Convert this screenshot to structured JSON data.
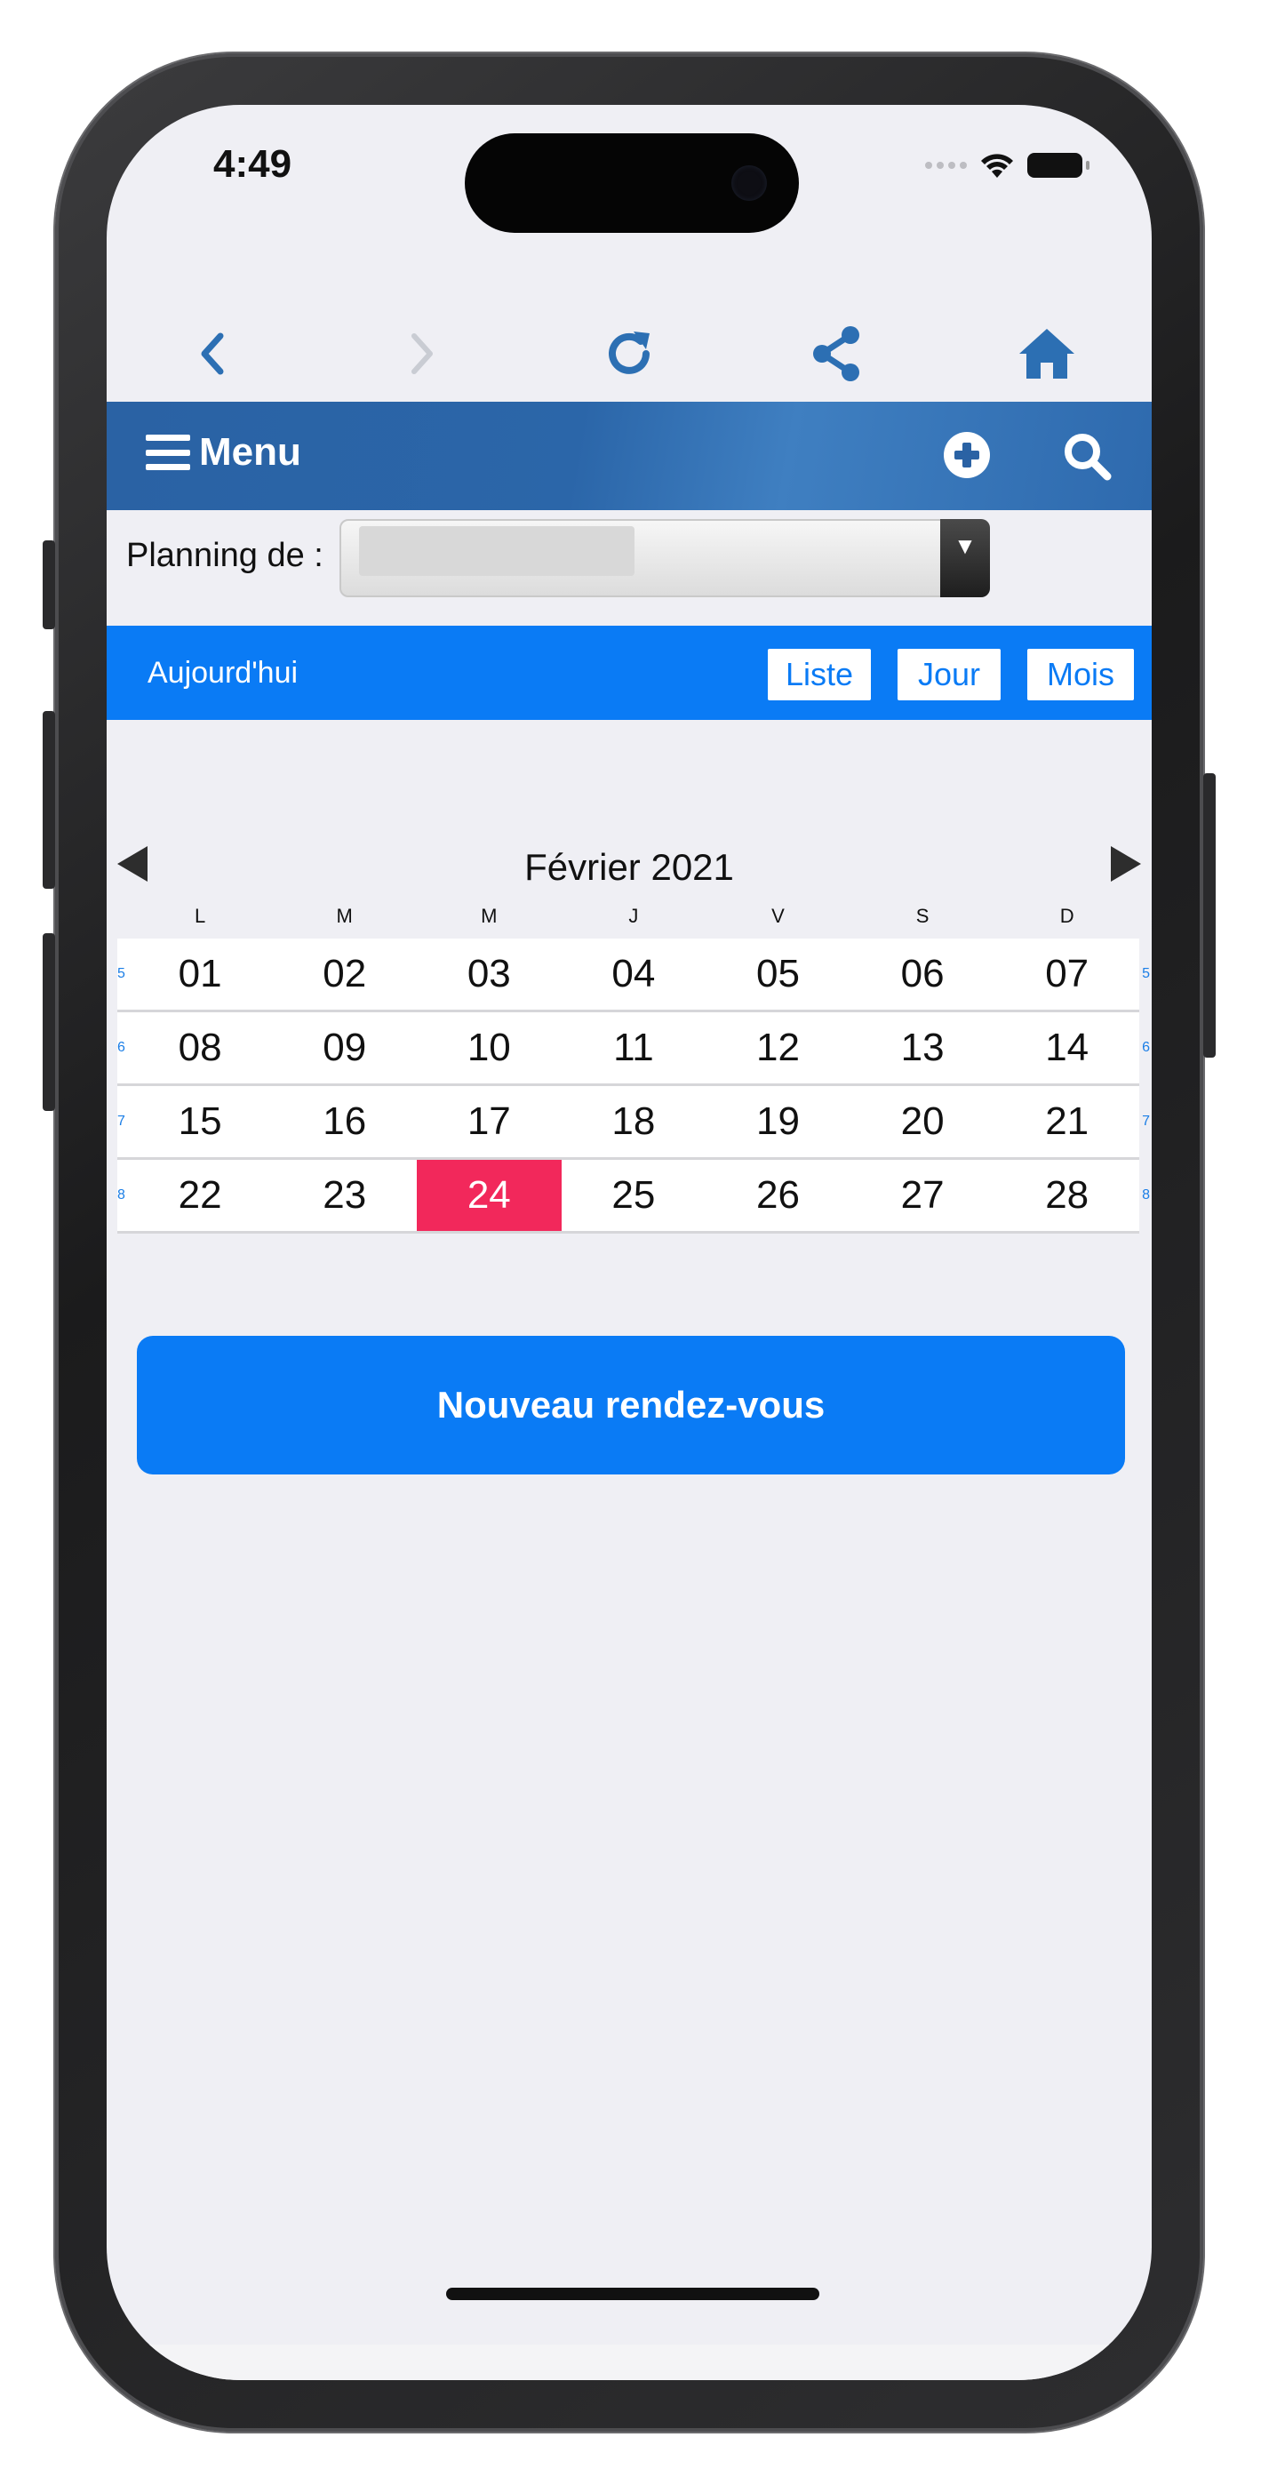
{
  "status_bar": {
    "time": "4:49"
  },
  "browser_bar": {
    "back_icon": "chevron-left-icon",
    "forward_icon": "chevron-right-icon",
    "reload_icon": "reload-icon",
    "share_icon": "share-icon",
    "home_icon": "home-icon"
  },
  "app_bar": {
    "menu_label": "Menu",
    "add_icon": "plus-circle-icon",
    "search_icon": "search-icon"
  },
  "planning": {
    "label": "Planning de :"
  },
  "toolbar": {
    "today_label": "Aujourd'hui",
    "views": [
      "Liste",
      "Jour",
      "Mois"
    ]
  },
  "calendar": {
    "month_title": "Février 2021",
    "weekdays": [
      "L",
      "M",
      "M",
      "J",
      "V",
      "S",
      "D"
    ],
    "weeks": [
      {
        "number": "5",
        "days": [
          "01",
          "02",
          "03",
          "04",
          "05",
          "06",
          "07"
        ]
      },
      {
        "number": "6",
        "days": [
          "08",
          "09",
          "10",
          "11",
          "12",
          "13",
          "14"
        ]
      },
      {
        "number": "7",
        "days": [
          "15",
          "16",
          "17",
          "18",
          "19",
          "20",
          "21"
        ]
      },
      {
        "number": "8",
        "days": [
          "22",
          "23",
          "24",
          "25",
          "26",
          "27",
          "28"
        ]
      }
    ],
    "today": "24"
  },
  "actions": {
    "new_appointment_label": "Nouveau rendez-vous"
  },
  "colors": {
    "accent": "#0a7bf5",
    "appbar": "#2a62a4",
    "today": "#f2285b"
  }
}
